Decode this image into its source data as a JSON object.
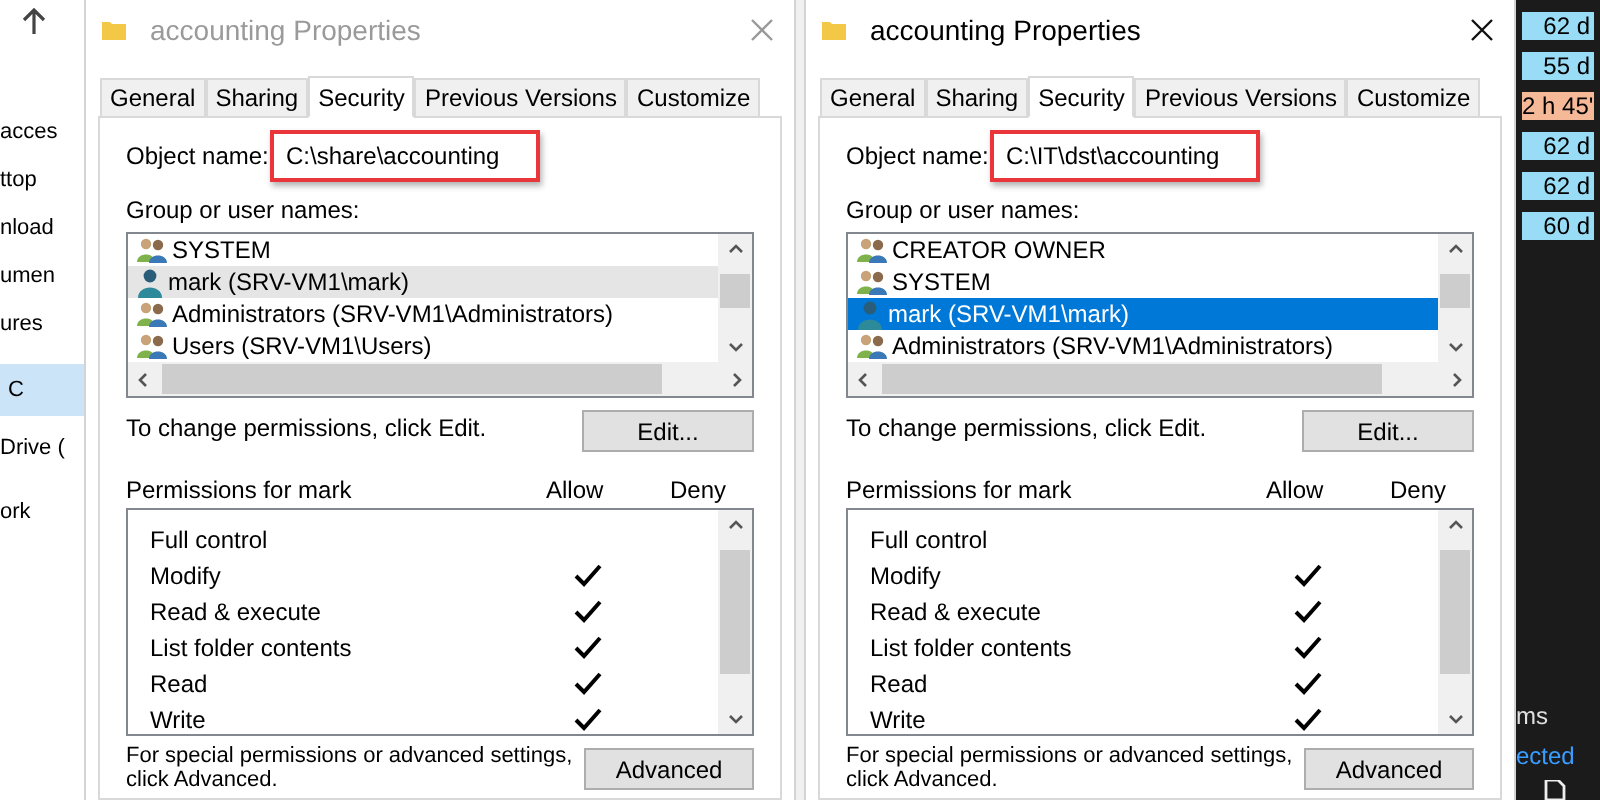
{
  "explorer_sidebar": {
    "items": [
      {
        "label": "acces",
        "selected": false
      },
      {
        "label": "ttop",
        "selected": false
      },
      {
        "label": "nload",
        "selected": false
      },
      {
        "label": "umen",
        "selected": false
      },
      {
        "label": "ures",
        "selected": false
      },
      {
        "label": "C",
        "selected": true
      },
      {
        "label": "Drive (",
        "selected": false
      },
      {
        "label": "ork",
        "selected": false
      }
    ]
  },
  "dialogs": [
    {
      "title": "accounting Properties",
      "active": false,
      "tabs": [
        {
          "label": "General",
          "selected": false
        },
        {
          "label": "Sharing",
          "selected": false
        },
        {
          "label": "Security",
          "selected": true
        },
        {
          "label": "Previous Versions",
          "selected": false
        },
        {
          "label": "Customize",
          "selected": false
        }
      ],
      "object_name_label": "Object name:",
      "object_name": "C:\\share\\accounting",
      "object_name_highlighted": true,
      "group_label": "Group or user names:",
      "principals": [
        {
          "name": "SYSTEM",
          "kind": "group",
          "selected": false
        },
        {
          "name": "mark (SRV-VM1\\mark)",
          "kind": "user",
          "selected": true
        },
        {
          "name": "Administrators (SRV-VM1\\Administrators)",
          "kind": "group",
          "selected": false
        },
        {
          "name": "Users (SRV-VM1\\Users)",
          "kind": "group",
          "selected": false
        }
      ],
      "edit_hint": "To change permissions, click Edit.",
      "edit_button": "Edit...",
      "permissions_label": "Permissions for mark",
      "allow_header": "Allow",
      "deny_header": "Deny",
      "permissions": [
        {
          "name": "Full control",
          "allow": false
        },
        {
          "name": "Modify",
          "allow": true
        },
        {
          "name": "Read & execute",
          "allow": true
        },
        {
          "name": "List folder contents",
          "allow": true
        },
        {
          "name": "Read",
          "allow": true
        },
        {
          "name": "Write",
          "allow": true
        }
      ],
      "advanced_hint": "For special permissions or advanced settings, click Advanced.",
      "advanced_button": "Advanced"
    },
    {
      "title": "accounting Properties",
      "active": true,
      "tabs": [
        {
          "label": "General",
          "selected": false
        },
        {
          "label": "Sharing",
          "selected": false
        },
        {
          "label": "Security",
          "selected": true
        },
        {
          "label": "Previous Versions",
          "selected": false
        },
        {
          "label": "Customize",
          "selected": false
        }
      ],
      "object_name_label": "Object name:",
      "object_name": "C:\\IT\\dst\\accounting",
      "object_name_highlighted": true,
      "group_label": "Group or user names:",
      "principals": [
        {
          "name": "CREATOR OWNER",
          "kind": "group",
          "selected": false
        },
        {
          "name": "SYSTEM",
          "kind": "group",
          "selected": false
        },
        {
          "name": "mark (SRV-VM1\\mark)",
          "kind": "user",
          "selected": true
        },
        {
          "name": "Administrators (SRV-VM1\\Administrators)",
          "kind": "group",
          "selected": false
        }
      ],
      "edit_hint": "To change permissions, click Edit.",
      "edit_button": "Edit...",
      "permissions_label": "Permissions for mark",
      "allow_header": "Allow",
      "deny_header": "Deny",
      "permissions": [
        {
          "name": "Full control",
          "allow": false
        },
        {
          "name": "Modify",
          "allow": true
        },
        {
          "name": "Read & execute",
          "allow": true
        },
        {
          "name": "List folder contents",
          "allow": true
        },
        {
          "name": "Read",
          "allow": true
        },
        {
          "name": "Write",
          "allow": true
        }
      ],
      "advanced_hint": "For special permissions or advanced settings, click Advanced.",
      "advanced_button": "Advanced"
    }
  ],
  "side_panel": {
    "badges": [
      {
        "label": "62 d",
        "color": "#99dcf5"
      },
      {
        "label": "55 d",
        "color": "#99dcf5"
      },
      {
        "label": "2 h 45'",
        "color": "#f5b998"
      },
      {
        "label": "62 d",
        "color": "#99dcf5"
      },
      {
        "label": "62 d",
        "color": "#99dcf5"
      },
      {
        "label": "60 d",
        "color": "#99dcf5"
      }
    ],
    "text_1": "ms",
    "text_2": "ected"
  }
}
